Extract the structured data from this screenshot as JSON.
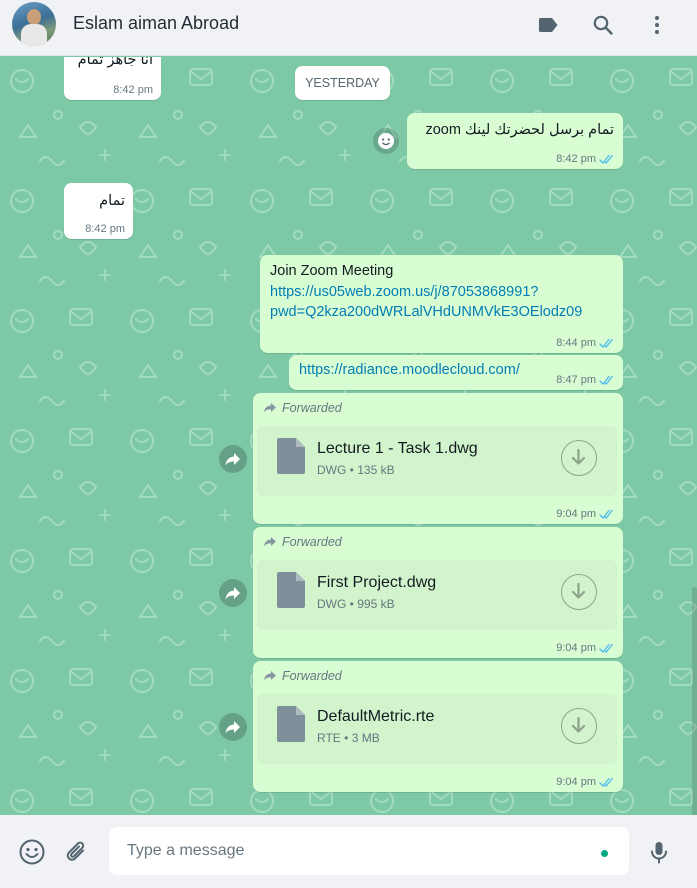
{
  "header": {
    "contact_name": "Eslam aiman Abroad",
    "icons": [
      "label-icon",
      "search-icon",
      "menu-icon"
    ]
  },
  "chat": {
    "date_divider": "YESTERDAY",
    "messages": [
      {
        "direction": "incoming",
        "text": "انا جاهز تمام",
        "time": "8:42 pm"
      },
      {
        "direction": "outgoing",
        "text": "تمام برسل لحضرتك لينك zoom",
        "time": "8:42 pm",
        "status": "read"
      },
      {
        "direction": "incoming",
        "text": "تمام",
        "time": "8:42 pm"
      },
      {
        "direction": "outgoing",
        "text": "Join Zoom Meeting",
        "link": "https://us05web.zoom.us/j/87053868991?pwd=Q2kza200dWRLalVHdUNMVkE3OElodz09",
        "link_line1": "https://us05web.zoom.us/j/87053868991?",
        "link_line2": "pwd=Q2kza200dWRLalVHdUNMVkE3OElodz09",
        "time": "8:44 pm",
        "status": "read"
      },
      {
        "direction": "outgoing",
        "link": "https://radiance.moodlecloud.com/",
        "time": "8:47 pm",
        "status": "read"
      },
      {
        "direction": "outgoing",
        "forwarded_label": "Forwarded",
        "file_name": "Lecture 1 - Task 1.dwg",
        "file_type": "DWG",
        "file_size": "135 kB",
        "time": "9:04 pm",
        "status": "read"
      },
      {
        "direction": "outgoing",
        "forwarded_label": "Forwarded",
        "file_name": "First Project.dwg",
        "file_type": "DWG",
        "file_size": "995 kB",
        "time": "9:04 pm",
        "status": "read"
      },
      {
        "direction": "outgoing",
        "forwarded_label": "Forwarded",
        "file_name": "DefaultMetric.rte",
        "file_type": "RTE",
        "file_size": "3 MB",
        "time": "9:04 pm",
        "status": "read"
      }
    ]
  },
  "composer": {
    "placeholder": "Type a message",
    "icons": [
      "emoji-icon",
      "attach-icon",
      "mic-icon"
    ]
  },
  "colors": {
    "chat_background": "#7ec9a5",
    "incoming_bubble": "#ffffff",
    "outgoing_bubble": "#d9fdd3",
    "read_ticks": "#53bdeb",
    "link": "#027eb5",
    "accent": "#00a884"
  }
}
